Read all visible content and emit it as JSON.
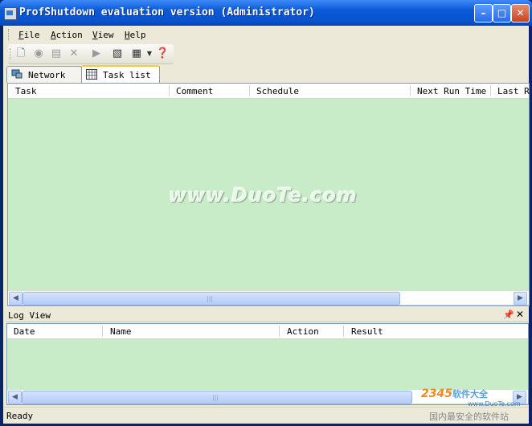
{
  "window": {
    "title": "ProfShutdown evaluation version (Administrator)"
  },
  "menu": {
    "items": [
      {
        "label": "File",
        "mnemonic": "F",
        "rest": "ile"
      },
      {
        "label": "Action",
        "mnemonic": "A",
        "rest": "ction"
      },
      {
        "label": "View",
        "mnemonic": "V",
        "rest": "iew"
      },
      {
        "label": "Help",
        "mnemonic": "H",
        "rest": "elp"
      }
    ]
  },
  "toolbar": {
    "icons": [
      "new-task-icon",
      "disabled-circle-icon",
      "properties-icon",
      "delete-icon",
      "run-icon",
      "console-icon",
      "view-grid-icon",
      "help-icon"
    ]
  },
  "tabs": [
    {
      "label": "Network",
      "icon": "network-icon",
      "active": false
    },
    {
      "label": "Task list",
      "icon": "calendar-grid-icon",
      "active": true
    }
  ],
  "task_grid": {
    "columns": [
      "Task",
      "Comment",
      "Schedule",
      "Next Run Time",
      "Last R"
    ],
    "rows": []
  },
  "watermark": "www.DuoTe.com",
  "log_view": {
    "title": "Log View",
    "columns": [
      "Date",
      "Name",
      "Action",
      "Result"
    ],
    "rows": []
  },
  "status": {
    "text": "Ready"
  },
  "corner_logo": {
    "number": "2345",
    "text": "软件大全",
    "url": "www.DuoTe.com",
    "tagline": "国内最安全的软件站"
  },
  "colors": {
    "grid_background": "#c8ecc8",
    "title_bar": "#0a5ad8"
  }
}
